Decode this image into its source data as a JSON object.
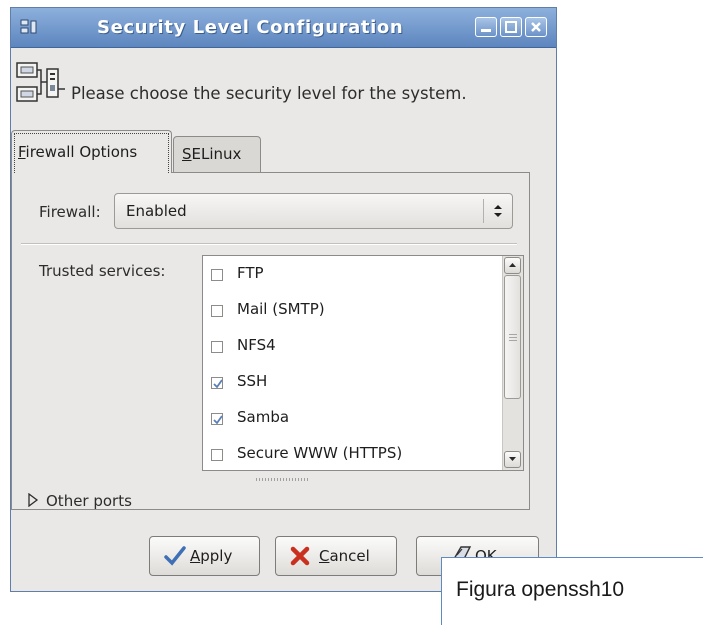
{
  "window": {
    "title": "Security Level Configuration",
    "header_text": "Please choose the security level for the system."
  },
  "tabs": [
    {
      "label": "Firewall Options",
      "mnemonic": "F",
      "rest": "irewall Options",
      "active": true
    },
    {
      "label": "SELinux",
      "mnemonic": "S",
      "rest": "ELinux",
      "active": false
    }
  ],
  "firewall": {
    "label": "Firewall:",
    "value": "Enabled"
  },
  "trusted_services": {
    "label": "Trusted services:",
    "items": [
      {
        "name": "FTP",
        "checked": false
      },
      {
        "name": "Mail (SMTP)",
        "checked": false
      },
      {
        "name": "NFS4",
        "checked": false
      },
      {
        "name": "SSH",
        "checked": true
      },
      {
        "name": "Samba",
        "checked": true
      },
      {
        "name": "Secure WWW (HTTPS)",
        "checked": false
      }
    ]
  },
  "other_ports": {
    "label": "Other ports"
  },
  "buttons": {
    "apply": {
      "mnemonic": "A",
      "rest": "pply"
    },
    "cancel": {
      "mnemonic": "C",
      "rest": "ancel"
    },
    "ok": {
      "label": "OK"
    }
  },
  "caption": "Figura openssh10",
  "colors": {
    "titlebar": "#6f96cc",
    "window_bg": "#e9e8e6",
    "check": "#5b7fb5"
  },
  "icons": {
    "window": "system-window-icon",
    "header": "network-computers-icon",
    "minimize": "minimize-icon",
    "maximize": "maximize-icon",
    "close": "close-icon",
    "apply": "checkmark-icon",
    "cancel": "x-icon",
    "ok": "ok-icon",
    "expander": "triangle-right-icon"
  }
}
